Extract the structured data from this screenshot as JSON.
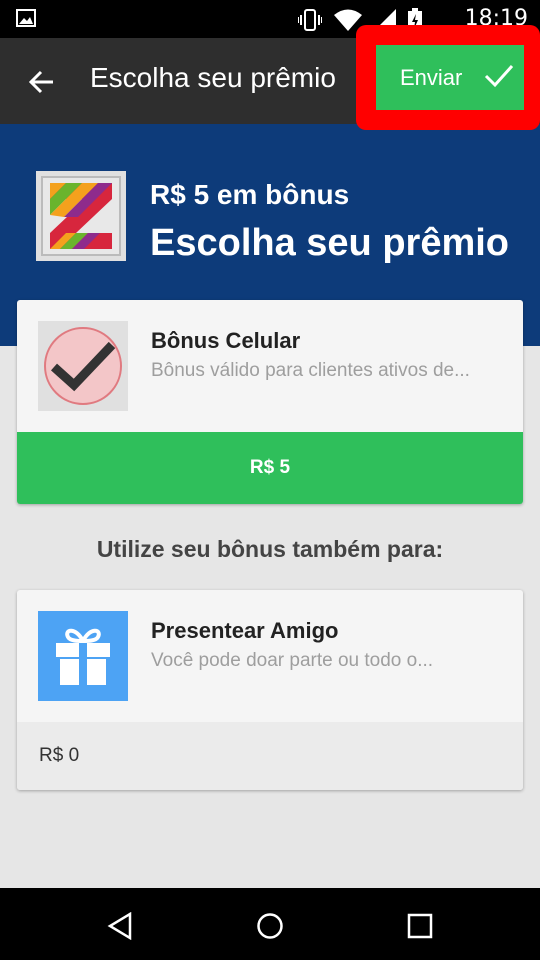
{
  "status_bar": {
    "time": "18:19",
    "icons": [
      "gallery-icon",
      "vibrate-icon",
      "wifi-icon",
      "signal-icon",
      "battery-charging-icon"
    ]
  },
  "app_bar": {
    "title": "Escolha seu prêmio",
    "send_label": "Enviar",
    "back_icon": "arrow-back-icon",
    "send_icon": "check-icon"
  },
  "hero": {
    "bonus_text": "R$ 5 em bônus",
    "title": "Escolha seu prêmio"
  },
  "rewards": [
    {
      "name": "Bônus Celular",
      "description": "Bônus válido para clientes ativos de...",
      "value": "R$ 5",
      "icon": "claro-check-icon"
    }
  ],
  "section_title": "Utilize seu bônus também para:",
  "other_uses": [
    {
      "name": "Presentear Amigo",
      "description": "Você pode doar parte ou todo o...",
      "value": "R$ 0",
      "icon": "gift-icon"
    }
  ],
  "colors": {
    "app_bar": "#2e2e2e",
    "hero": "#0d3b7a",
    "accent_green": "#2fbf5b",
    "highlight_red": "#ff0000",
    "gift_blue": "#4da3f4"
  }
}
